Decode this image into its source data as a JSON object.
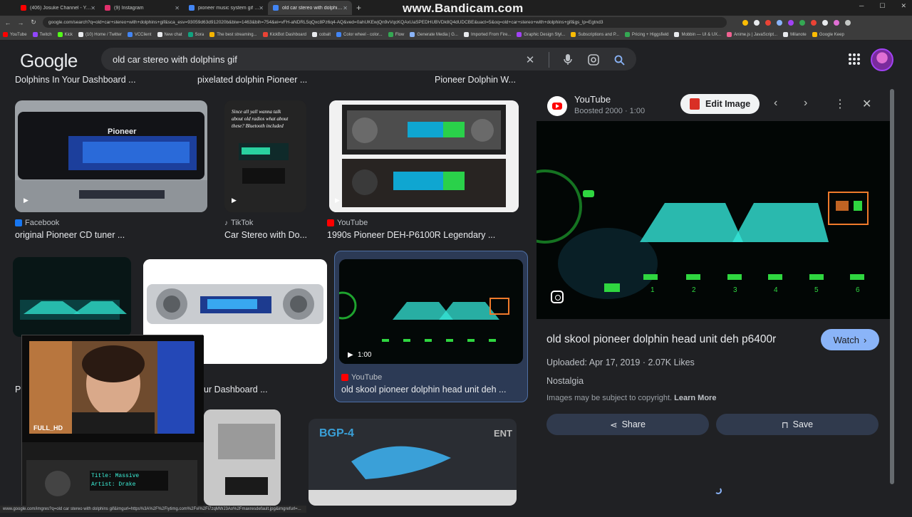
{
  "browser": {
    "watermark": "www.Bandicam.com",
    "tabs": [
      {
        "label": "(406) Josuke Channel - YouTub",
        "color": "#ff0000"
      },
      {
        "label": "(9) Instagram",
        "color": "#e1306c"
      },
      {
        "label": "pioneer music system gif - Goo",
        "color": "#4285f4"
      },
      {
        "label": "old car stereo with dolphins gif",
        "color": "#4285f4",
        "active": true
      }
    ],
    "url": "google.com/search?q=old+car+stereo+with+dolphins+gif&sca_esv=93059d63d912020b&biw=1463&bih=754&ei=vFH-aNDRL5qQxc8Pz6q4-AQ&ved=0ahUKEwjQn9vVqcKQAxUaSPEDHUBVDk8Q4dUDCBE&uact=5&oq=old+car+stereo+with+dolphins+gif&gs_lp=Egtnd3",
    "bookmarks": [
      "YouTube",
      "Twitch",
      "Kick",
      "(10) Home / Twitter",
      "VCClient",
      "New chat",
      "Sora",
      "The best streaming...",
      "KickBot Dashboard",
      "cobalt",
      "Color wheel - color...",
      "Flow",
      "Generate Media | G...",
      "Imported From Fire...",
      "Graphic Design Styl...",
      "Subscriptions and P...",
      "Pricing + Higgsfield",
      "Mobbin — UI & UX...",
      "Anime.js | JavaScript...",
      "Milanote",
      "Google Keep"
    ]
  },
  "google": {
    "logo": "Google",
    "query": "old car stereo with dolphins gif"
  },
  "results": {
    "top_captions": [
      "Dolphins In Your Dashboard ...",
      "pixelated dolphin Pioneer ...",
      "Pioneer Dolphin W..."
    ],
    "row1": [
      {
        "source": "Facebook",
        "title": "original Pioneer CD tuner ..."
      },
      {
        "source": "TikTok",
        "title": "Car Stereo with Do..."
      },
      {
        "source": "YouTube",
        "title": "1990s Pioneer DEH-P6100R Legendary ..."
      }
    ],
    "row2": [
      {
        "source": "",
        "title": "P"
      },
      {
        "source": "",
        "title": "ur Dashboard ..."
      },
      {
        "source": "YouTube",
        "title": "old skool pioneer dolphin head unit deh ...",
        "duration": "1:00"
      }
    ]
  },
  "overlay": {
    "badge": "FULL_HD",
    "track_title": "Title: Massive",
    "track_artist": "Artist: Drake"
  },
  "panel": {
    "channel": "YouTube",
    "sub": "Boosted 2000 · 1:00",
    "edit_label": "Edit Image",
    "title": "old skool pioneer dolphin head unit deh p6400r",
    "watch_label": "Watch",
    "meta": "Uploaded: Apr 17, 2019  ·  2.07K Likes",
    "category": "Nostalgia",
    "copyright": "Images may be subject to copyright.",
    "learn_more": "Learn More",
    "share_label": "Share",
    "save_label": "Save",
    "preset_labels": [
      "1",
      "2",
      "3",
      "4",
      "5",
      "6"
    ]
  },
  "status_url": "www.google.com/imgres?q=old car stereo with dolphins gif&imgurl=https%3A%2F%2Fiytimg.com%2Fvi%2Fi7zqMWJ3Ao%2Fmaxresdefault.jpg&imgrefurl=...",
  "colors": {
    "accent": "#8ab4f8",
    "bg": "#202124",
    "youtube": "#ff0000"
  }
}
